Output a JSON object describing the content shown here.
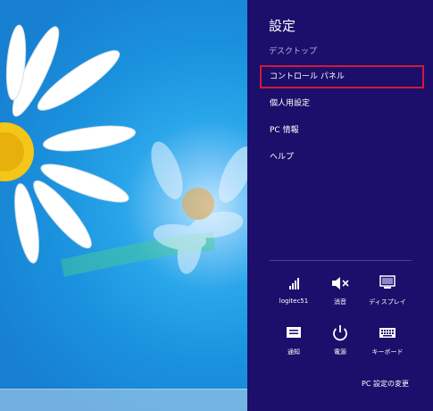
{
  "charms": {
    "title": "設定",
    "context": "デスクトップ",
    "items": [
      {
        "label": "コントロール パネル",
        "selected": true
      },
      {
        "label": "個人用設定"
      },
      {
        "label": "PC 情報"
      },
      {
        "label": "ヘルプ"
      }
    ],
    "quick": [
      {
        "label": "logitec51",
        "icon": "wifi-signal-icon"
      },
      {
        "label": "消音",
        "icon": "speaker-muted-icon"
      },
      {
        "label": "ディスプレイ",
        "icon": "display-icon"
      },
      {
        "label": "通知",
        "icon": "notifications-icon"
      },
      {
        "label": "電源",
        "icon": "power-icon"
      },
      {
        "label": "キーボード",
        "icon": "keyboard-icon"
      }
    ],
    "change_settings": "PC 設定の変更",
    "colors": {
      "panel": "#1b0f6b",
      "highlight": "#d3183b"
    }
  }
}
